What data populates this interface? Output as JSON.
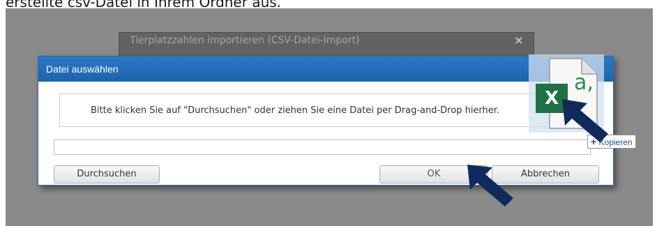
{
  "caption": "erstellte csv-Datei in Ihrem Ordner aus.",
  "background_dialog": {
    "title": "Tierplatzzahlen importieren (CSV-Datei-Import)",
    "close_glyph": "×"
  },
  "dialog": {
    "title": "Datei auswählen",
    "drop_zone_text": "Bitte klicken Sie auf \"Durchsuchen\" oder ziehen Sie eine Datei per Drag-and-Drop hierher.",
    "file_path_value": "",
    "buttons": {
      "browse": "Durchsuchen",
      "ok": "OK",
      "cancel": "Abbrechen"
    }
  },
  "drag": {
    "file_icon": "excel-file-icon",
    "tile_letter": "X",
    "tile_suffix": "a,",
    "copy_plus": "+",
    "copy_label": "Kopieren"
  },
  "colors": {
    "titlebar": "#2b78c7",
    "excel_green": "#1f7244",
    "arrow": "#0f2a5c"
  }
}
